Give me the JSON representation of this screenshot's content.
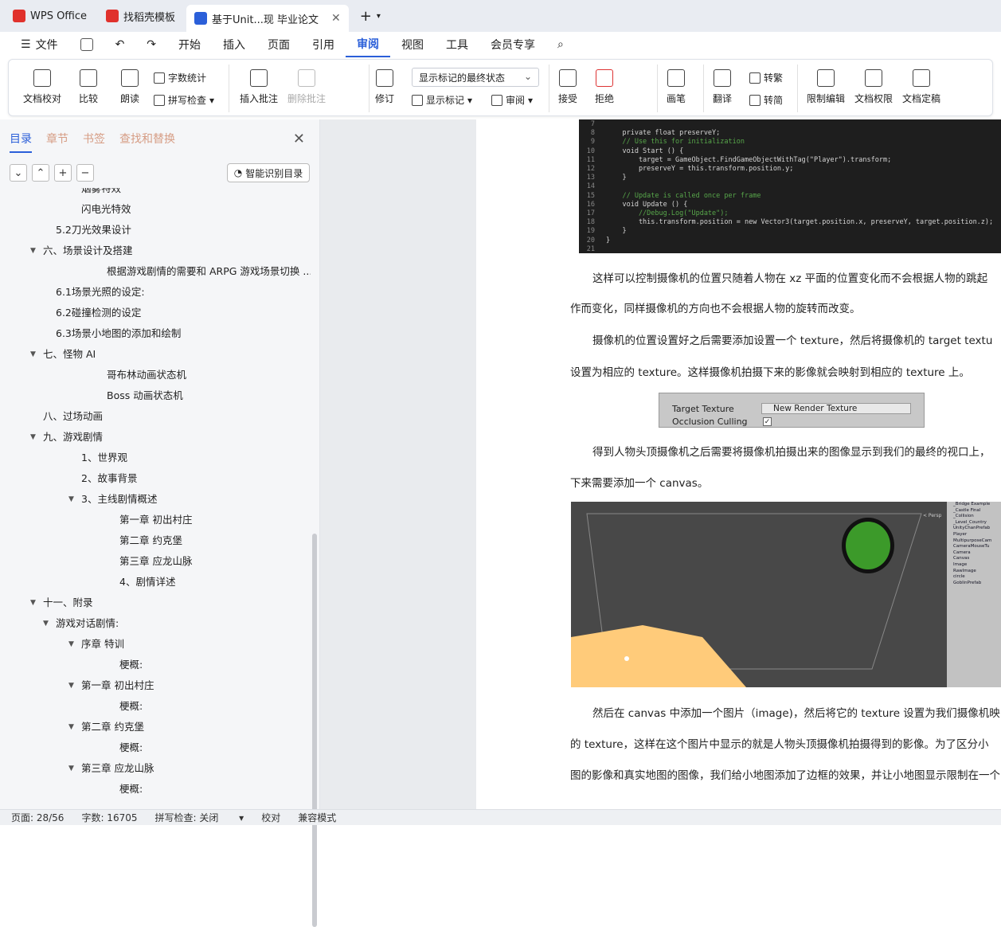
{
  "tabs": {
    "wps": "WPS Office",
    "template": "找稻壳模板",
    "doc": "基于Unit...现 毕业论文",
    "new_tab": "+"
  },
  "menu": {
    "file": "文件",
    "items": [
      "开始",
      "插入",
      "页面",
      "引用",
      "审阅",
      "视图",
      "工具",
      "会员专享"
    ],
    "active": "审阅"
  },
  "ribbon": {
    "doc_check": "文档校对",
    "compare": "比较",
    "read_aloud": "朗读",
    "word_count": "字数统计",
    "spell_check": "拼写检查",
    "insert_comment": "插入批注",
    "delete_comment": "删除批注",
    "revise": "修订",
    "markup_state": "显示标记的最终状态",
    "show_markup": "显示标记",
    "review": "审阅",
    "accept": "接受",
    "reject": "拒绝",
    "pen": "画笔",
    "translate": "翻译",
    "to_trad": "转繁",
    "to_simp": "转简",
    "restrict_edit": "限制编辑",
    "doc_rights": "文档权限",
    "doc_finalize": "文档定稿"
  },
  "sidebar": {
    "tabs": [
      "目录",
      "章节",
      "书签",
      "查找和替换"
    ],
    "smart_toc": "智能识别目录",
    "toc": [
      {
        "text": "烟雾特效",
        "lvl": 4
      },
      {
        "text": "闪电光特效",
        "lvl": 4
      },
      {
        "text": "5.2刀光效果设计",
        "lvl": 2
      },
      {
        "text": "六、场景设计及搭建",
        "lvl": 1,
        "open": true
      },
      {
        "text": "根据游戏剧情的需要和 ARPG 游戏场景切换 ...",
        "lvl": 5
      },
      {
        "text": "6.1场景光照的设定:",
        "lvl": 2
      },
      {
        "text": "6.2碰撞检测的设定",
        "lvl": 2
      },
      {
        "text": "6.3场景小地图的添加和绘制",
        "lvl": 2
      },
      {
        "text": "七、怪物 AI",
        "lvl": 1,
        "open": true
      },
      {
        "text": "哥布林动画状态机",
        "lvl": 5
      },
      {
        "text": "Boss 动画状态机",
        "lvl": 5
      },
      {
        "text": "八、过场动画",
        "lvl": 1
      },
      {
        "text": "九、游戏剧情",
        "lvl": 1,
        "open": true
      },
      {
        "text": "1、世界观",
        "lvl": 3
      },
      {
        "text": "2、故事背景",
        "lvl": 3
      },
      {
        "text": "3、主线剧情概述",
        "lvl": 3,
        "open": true
      },
      {
        "text": "第一章 初出村庄",
        "lvl": 6
      },
      {
        "text": "第二章 约克堡",
        "lvl": 6
      },
      {
        "text": "第三章 应龙山脉",
        "lvl": 6
      },
      {
        "text": "4、剧情详述",
        "lvl": 6
      },
      {
        "text": "十一、附录",
        "lvl": 1,
        "open": true
      },
      {
        "text": "游戏对话剧情:",
        "lvl": 2,
        "open": true
      },
      {
        "text": "序章 特训",
        "lvl": 3,
        "open": true
      },
      {
        "text": "梗概:",
        "lvl": 6
      },
      {
        "text": "第一章 初出村庄",
        "lvl": 3,
        "open": true
      },
      {
        "text": "梗概:",
        "lvl": 6
      },
      {
        "text": "第二章 约克堡",
        "lvl": 3,
        "open": true
      },
      {
        "text": "梗概:",
        "lvl": 6
      },
      {
        "text": "第三章 应龙山脉",
        "lvl": 3,
        "open": true
      },
      {
        "text": "梗概:",
        "lvl": 6
      }
    ]
  },
  "doc": {
    "code": [
      {
        "n": "7",
        "t": ""
      },
      {
        "n": "8",
        "t": "    private float preserveY;"
      },
      {
        "n": "9",
        "t": "    // Use this for initialization"
      },
      {
        "n": "10",
        "t": "    void Start () {"
      },
      {
        "n": "11",
        "t": "        target = GameObject.FindGameObjectWithTag(\"Player\").transform;"
      },
      {
        "n": "12",
        "t": "        preserveY = this.transform.position.y;"
      },
      {
        "n": "13",
        "t": "    }"
      },
      {
        "n": "14",
        "t": ""
      },
      {
        "n": "15",
        "t": "    // Update is called once per frame"
      },
      {
        "n": "16",
        "t": "    void Update () {"
      },
      {
        "n": "17",
        "t": "        //Debug.Log(\"Update\");"
      },
      {
        "n": "18",
        "t": "        this.transform.position = new Vector3(target.position.x, preserveY, target.position.z);"
      },
      {
        "n": "19",
        "t": "    }"
      },
      {
        "n": "20",
        "t": "}"
      },
      {
        "n": "21",
        "t": ""
      }
    ],
    "p1a": "这样可以控制摄像机的位置只随着人物在 xz 平面的位置变化而不会根据人物的跳起",
    "p1b": "作而变化，同样摄像机的方向也不会根据人物的旋转而改变。",
    "p2a": "摄像机的位置设置好之后需要添加设置一个 texture，然后将摄像机的 target textu",
    "p2b": "设置为相应的 texture。这样摄像机拍摄下来的影像就会映射到相应的 texture 上。",
    "insp_target": "Target Texture",
    "insp_value": "New Render Texture",
    "insp_occ": "Occlusion Culling",
    "p3a": "得到人物头顶摄像机之后需要将摄像机拍摄出来的图像显示到我们的最终的视口上，",
    "p3b": "下来需要添加一个 canvas。",
    "hier": [
      "_Bridge Example",
      "_Castle Final",
      "_Collision",
      "_Level_Country",
      "UnityChanPrefab",
      "Player",
      "MultipurposeCam",
      "CameraMouseTu",
      "Camera",
      "Canvas",
      "Image",
      "RawImage",
      "circle",
      "GoblinPrefab"
    ],
    "persp": "< Persp",
    "p4a": "然后在 canvas 中添加一个图片（image)，然后将它的 texture 设置为我们摄像机映",
    "p4b": "的 texture，这样在这个图片中显示的就是人物头顶摄像机拍摄得到的影像。为了区分小",
    "p4c": "图的影像和真实地图的图像，我们给小地图添加了边框的效果，并让小地图显示限制在一个"
  },
  "status": {
    "page": "页面: 28/56",
    "words": "字数: 16705",
    "spell": "拼写检查: 关闭",
    "proof": "校对",
    "compat": "兼容模式"
  },
  "colors": {
    "accent": "#2b5fd9",
    "wps_red": "#e0312c"
  }
}
